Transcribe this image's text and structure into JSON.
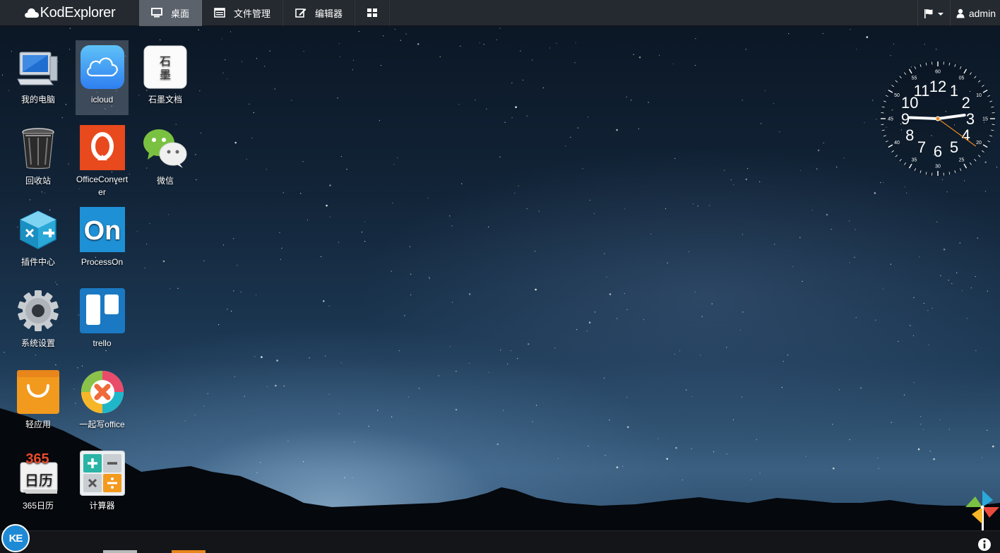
{
  "brand": {
    "name": "KodExplorer"
  },
  "nav": {
    "tabs": [
      {
        "label": "桌面",
        "icon": "desktop-icon",
        "active": true
      },
      {
        "label": "文件管理",
        "icon": "file-manager-icon",
        "active": false
      },
      {
        "label": "编辑器",
        "icon": "editor-icon",
        "active": false
      }
    ],
    "grid_icon": "grid-icon"
  },
  "topright": {
    "language_icon": "flag-icon",
    "user": "admin"
  },
  "desktop": {
    "icons": [
      {
        "label": "我的电脑",
        "icon": "computer-icon"
      },
      {
        "label": "icloud",
        "icon": "icloud-icon",
        "selected": true
      },
      {
        "label": "石墨文档",
        "icon": "shimo-icon",
        "logo_text": "石墨"
      },
      {
        "label": "回收站",
        "icon": "recycle-bin-icon"
      },
      {
        "label": "OfficeConverter",
        "icon": "office-converter-icon"
      },
      {
        "label": "微信",
        "icon": "wechat-icon"
      },
      {
        "label": "插件中心",
        "icon": "plugin-center-icon"
      },
      {
        "label": "ProcessOn",
        "icon": "processon-icon",
        "logo_text": "On"
      },
      {
        "label": "系统设置",
        "icon": "settings-gear-icon"
      },
      {
        "label": "trello",
        "icon": "trello-icon"
      },
      {
        "label": "轻应用",
        "icon": "light-app-icon"
      },
      {
        "label": "一起写office",
        "icon": "yiqixie-icon"
      },
      {
        "label": "365日历",
        "icon": "calendar-365-icon",
        "logo_text": "日历",
        "logo_number": "365"
      },
      {
        "label": "计算器",
        "icon": "calculator-icon"
      }
    ]
  },
  "clock": {
    "hour_numbers": [
      "12",
      "1",
      "2",
      "3",
      "4",
      "5",
      "6",
      "7",
      "8",
      "9",
      "10",
      "11"
    ],
    "minute_numbers": [
      "60",
      "05",
      "10",
      "15",
      "20",
      "25",
      "30",
      "35",
      "40",
      "45",
      "50",
      "55"
    ],
    "time": {
      "hour": 2,
      "minute": 45,
      "second": 21
    }
  },
  "taskbar": {
    "start_label": "KE",
    "info_icon": "info-icon",
    "widget_icon": "pinwheel-icon"
  },
  "colors": {
    "topbar": "#2c3036",
    "active_tab": "#6e7680",
    "start_button": "#1e8ad6"
  }
}
